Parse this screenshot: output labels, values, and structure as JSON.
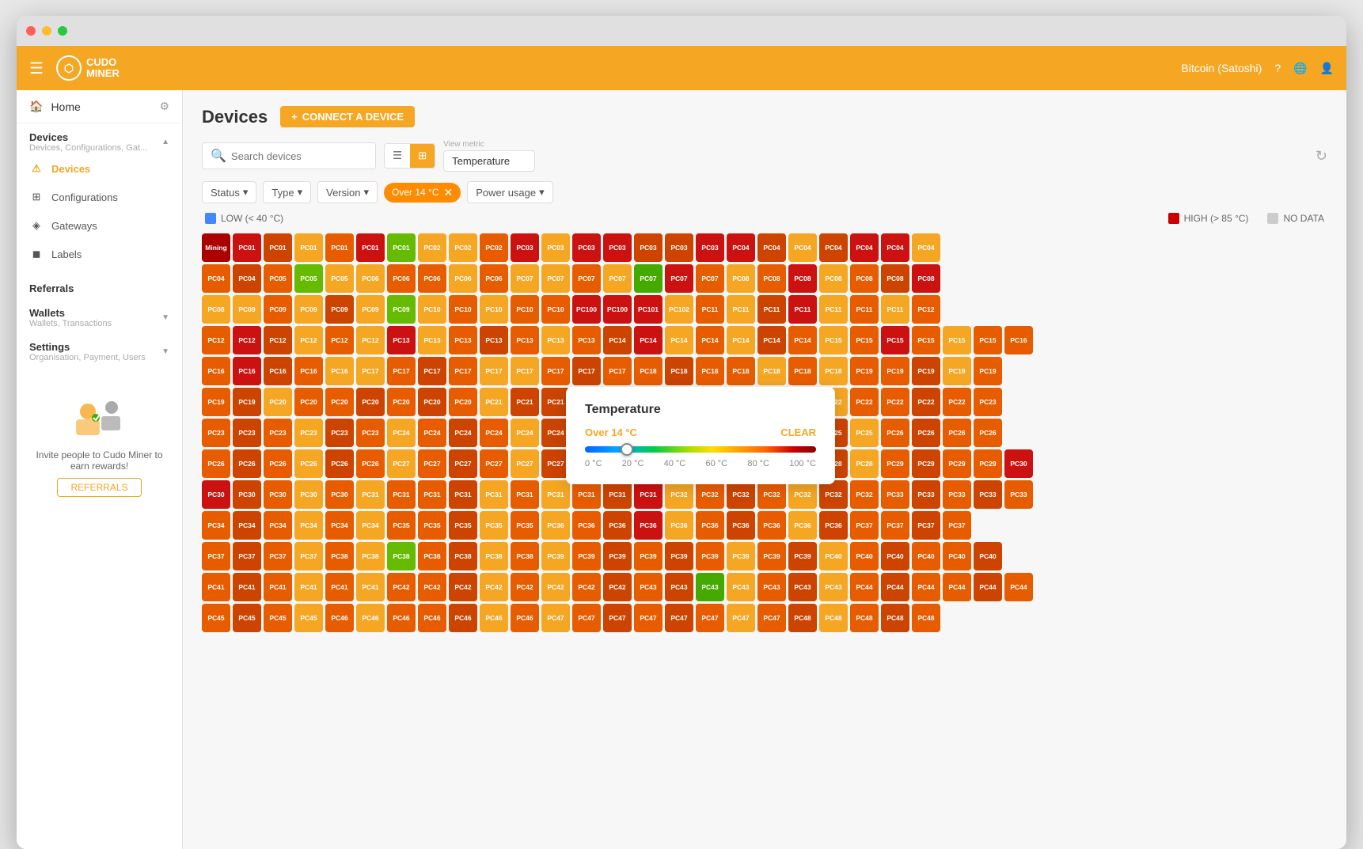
{
  "window": {
    "title": "Cudo Miner"
  },
  "topnav": {
    "logo": "CUDO\nMINER",
    "currency": "Bitcoin (Satoshi)"
  },
  "sidebar": {
    "home_label": "Home",
    "devices_section_title": "Devices",
    "devices_section_sub": "Devices, Configurations, Gat...",
    "nav_items": [
      {
        "id": "devices",
        "label": "Devices",
        "active": true
      },
      {
        "id": "configurations",
        "label": "Configurations",
        "active": false
      },
      {
        "id": "gateways",
        "label": "Gateways",
        "active": false
      },
      {
        "id": "labels",
        "label": "Labels",
        "active": false
      }
    ],
    "referrals_label": "Referrals",
    "wallets_title": "Wallets",
    "wallets_sub": "Wallets, Transactions",
    "settings_title": "Settings",
    "settings_sub": "Organisation, Payment, Users",
    "referrals_text": "Invite people to Cudo Miner to earn rewards!",
    "referrals_btn": "REFERRALS"
  },
  "page": {
    "title": "Devices",
    "connect_btn": "CONNECT A DEVICE"
  },
  "toolbar": {
    "search_placeholder": "Search devices",
    "view_metric_label": "View metric",
    "view_metric_value": "Temperature"
  },
  "filters": {
    "status_label": "Status",
    "type_label": "Type",
    "version_label": "Version",
    "active_filter": "Over 14 °C",
    "power_usage_label": "Power usage"
  },
  "legend": {
    "low_label": "LOW (< 40 °C)",
    "high_label": "HIGH (> 85 °C)",
    "no_data_label": "NO DATA",
    "low_color": "#4488ff",
    "high_color": "#cc0000",
    "no_data_color": "#cccccc"
  },
  "temp_popup": {
    "title": "Temperature",
    "filter_value": "Over 14 °C",
    "clear_label": "CLEAR",
    "slider_labels": [
      "0 °C",
      "20 °C",
      "40 °C",
      "60 °C",
      "80 °C",
      "100 °C"
    ]
  }
}
